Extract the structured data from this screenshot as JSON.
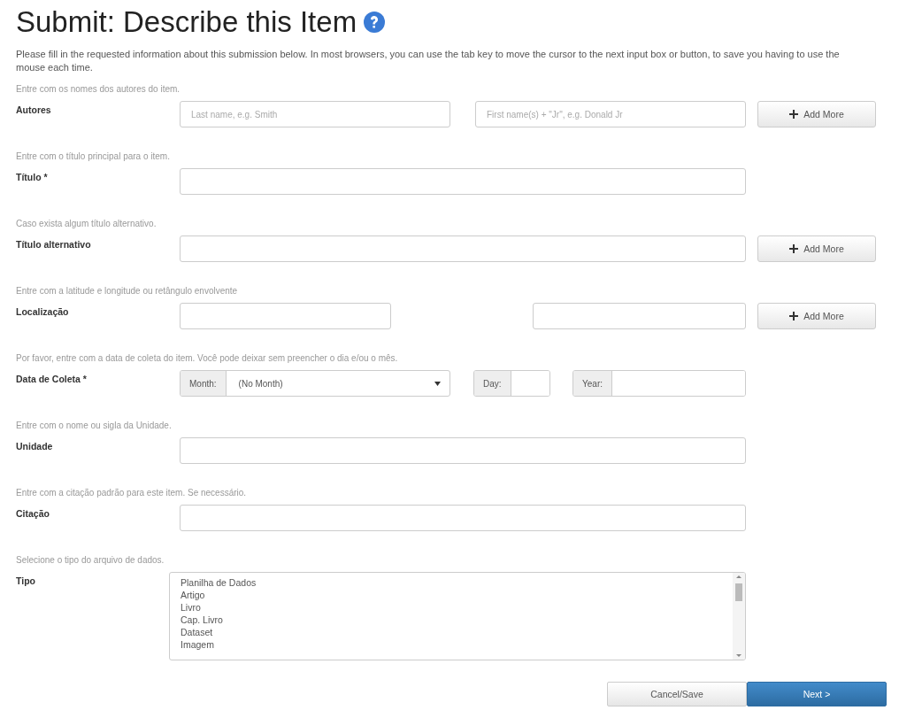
{
  "page": {
    "title": "Submit: Describe this Item",
    "intro": "Please fill in the requested information about this submission below. In most browsers, you can use the tab key to move the cursor to the next input box or button, to save you having to use the mouse each time."
  },
  "fields": [
    {
      "kind": "names",
      "hint": "Entre com os nomes dos autores do item.",
      "label": "Autores",
      "placeholders": [
        "Last name, e.g. Smith",
        "First name(s) + \"Jr\", e.g. Donald Jr"
      ],
      "add_more": "Add More"
    },
    {
      "kind": "text",
      "hint": "Entre com o título principal para o item.",
      "label": "Título *"
    },
    {
      "kind": "text",
      "hint": "Caso exista algum título alternativo.",
      "label": "Título alternativo",
      "add_more": "Add More"
    },
    {
      "kind": "pair",
      "hint": "Entre com a latitude e longitude ou retângulo envolvente",
      "label": "Localização",
      "add_more": "Add More"
    },
    {
      "kind": "date",
      "hint": "Por favor, entre com a data de coleta do item. Você pode deixar sem preencher o dia e/ou o mês.",
      "label": "Data de Coleta *",
      "month_label": "Month:",
      "month_value": "(No Month)",
      "day_label": "Day:",
      "year_label": "Year:"
    },
    {
      "kind": "text",
      "hint": "Entre com o nome ou sigla da Unidade.",
      "label": "Unidade"
    },
    {
      "kind": "text",
      "hint": "Entre com a citação padrão para este item. Se necessário.",
      "label": "Citação"
    },
    {
      "kind": "list",
      "hint": "Selecione o tipo do arquivo de dados.",
      "label": "Tipo",
      "options": [
        "Planilha de Dados",
        "Artigo",
        "Livro",
        "Cap. Livro",
        "Dataset",
        "Imagem"
      ]
    }
  ],
  "buttons": [
    {
      "kind": "default",
      "label": "Cancel/Save"
    },
    {
      "kind": "primary",
      "label": "Next >"
    }
  ]
}
